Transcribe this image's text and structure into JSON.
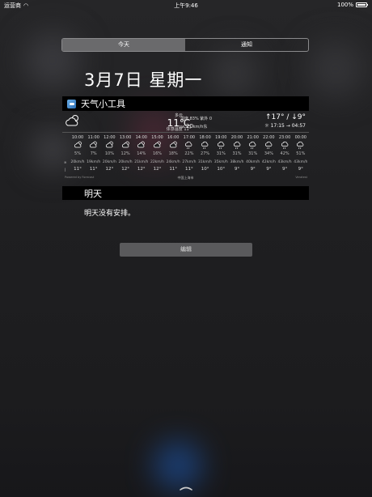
{
  "status_bar": {
    "carrier": "运营商",
    "time": "上午9:46",
    "battery": "100%"
  },
  "segments": {
    "today": "今天",
    "notifications": "通知"
  },
  "date": "3月7日 星期一",
  "widget": {
    "name": "天气小工具"
  },
  "weather": {
    "condition": "多云",
    "temperature": "11℃",
    "feels_like": "体感温度 11°",
    "humidity_uv": "湿度 83%   紫外 0",
    "wind_prefix": "nw",
    "wind_value": "20",
    "wind_suffix": "km/h东",
    "hi_lo": "↑17° / ↓9°",
    "sun": "17:15 → 04:57",
    "powered_by": "Powered by Forecast",
    "city": "中国上海市",
    "brand": "Veratest"
  },
  "hourly": [
    {
      "time": "10:00",
      "icon": "partly-cloudy-icon",
      "precip": "5%",
      "wind": "20km/h",
      "temp": "11°"
    },
    {
      "time": "11:00",
      "icon": "partly-cloudy-icon",
      "precip": "7%",
      "wind": "19km/h",
      "temp": "11°"
    },
    {
      "time": "12:00",
      "icon": "partly-cloudy-icon",
      "precip": "10%",
      "wind": "20km/h",
      "temp": "12°"
    },
    {
      "time": "13:00",
      "icon": "partly-cloudy-icon",
      "precip": "12%",
      "wind": "20km/h",
      "temp": "12°"
    },
    {
      "time": "14:00",
      "icon": "partly-cloudy-icon",
      "precip": "14%",
      "wind": "21km/h",
      "temp": "12°"
    },
    {
      "time": "15:00",
      "icon": "partly-cloudy-icon",
      "precip": "16%",
      "wind": "22km/h",
      "temp": "12°"
    },
    {
      "time": "16:00",
      "icon": "partly-cloudy-icon",
      "precip": "18%",
      "wind": "24km/h",
      "temp": "11°"
    },
    {
      "time": "17:00",
      "icon": "rain-icon",
      "precip": "22%",
      "wind": "27km/h",
      "temp": "11°"
    },
    {
      "time": "18:00",
      "icon": "rain-icon",
      "precip": "27%",
      "wind": "31km/h",
      "temp": "10°"
    },
    {
      "time": "19:00",
      "icon": "rain-icon",
      "precip": "31%",
      "wind": "35km/h",
      "temp": "10°"
    },
    {
      "time": "20:00",
      "icon": "rain-icon",
      "precip": "31%",
      "wind": "38km/h",
      "temp": "9°"
    },
    {
      "time": "21:00",
      "icon": "rain-icon",
      "precip": "31%",
      "wind": "40km/h",
      "temp": "9°"
    },
    {
      "time": "22:00",
      "icon": "rain-icon",
      "precip": "34%",
      "wind": "42km/h",
      "temp": "9°"
    },
    {
      "time": "23:00",
      "icon": "rain-icon",
      "precip": "42%",
      "wind": "43km/h",
      "temp": "9°"
    },
    {
      "time": "00:00",
      "icon": "rain-icon",
      "precip": "51%",
      "wind": "43km/h",
      "temp": "9°"
    }
  ],
  "tomorrow": {
    "title": "明天",
    "text": "明天没有安排。"
  },
  "edit_label": "编辑",
  "colors": {
    "background": "#1c1c1e",
    "header_bar": "#000000",
    "segment_active": "#6a6a6c",
    "edit_button": "#5a5a5c"
  }
}
